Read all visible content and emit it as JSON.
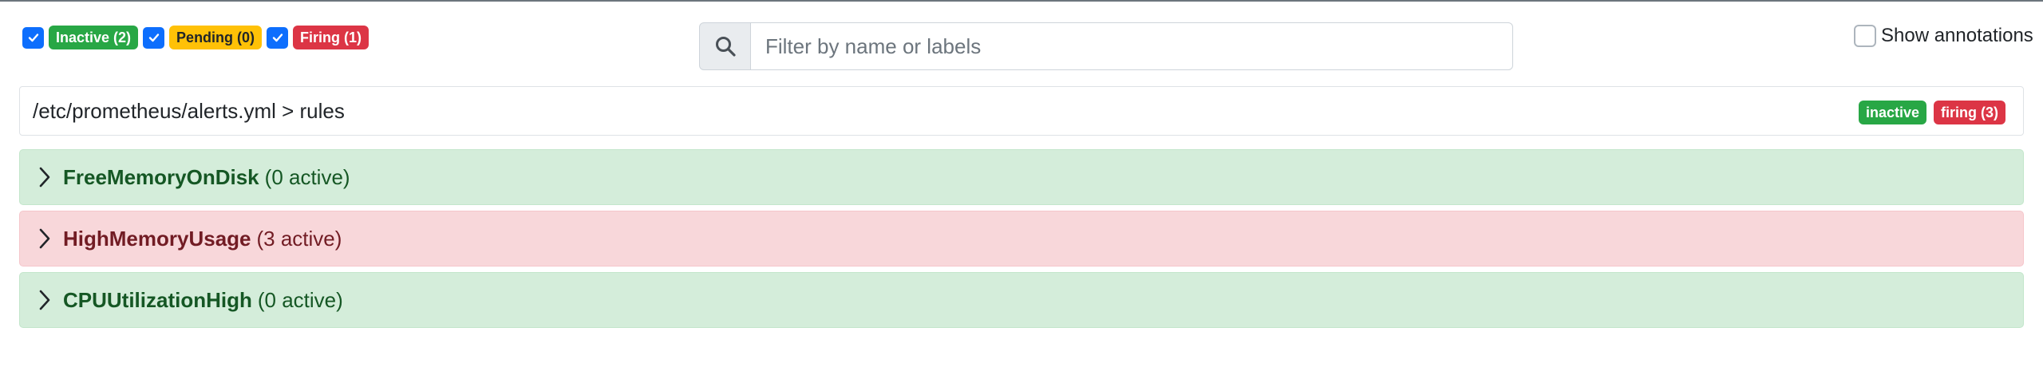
{
  "filters": [
    {
      "label": "Inactive (2)",
      "checked": true,
      "color": "#28a745"
    },
    {
      "label": "Pending (0)",
      "checked": true,
      "color": "#ffc107"
    },
    {
      "label": "Firing (1)",
      "checked": true,
      "color": "#dc3545"
    }
  ],
  "search": {
    "placeholder": "Filter by name or labels",
    "value": "",
    "icon": "search-icon"
  },
  "show_annotations": {
    "label": "Show annotations",
    "checked": false
  },
  "group": {
    "title": "/etc/prometheus/alerts.yml > rules",
    "badges": [
      {
        "label": "inactive",
        "color": "#28a745"
      },
      {
        "label": "firing (3)",
        "color": "#dc3545"
      }
    ]
  },
  "rules": [
    {
      "name": "FreeMemoryOnDisk",
      "count": "(0 active)",
      "state": "inactive",
      "color": "#d4edda"
    },
    {
      "name": "HighMemoryUsage",
      "count": "(3 active)",
      "state": "firing",
      "color": "#f8d7da"
    },
    {
      "name": "CPUUtilizationHigh",
      "count": "(0 active)",
      "state": "inactive",
      "color": "#d4edda"
    }
  ]
}
